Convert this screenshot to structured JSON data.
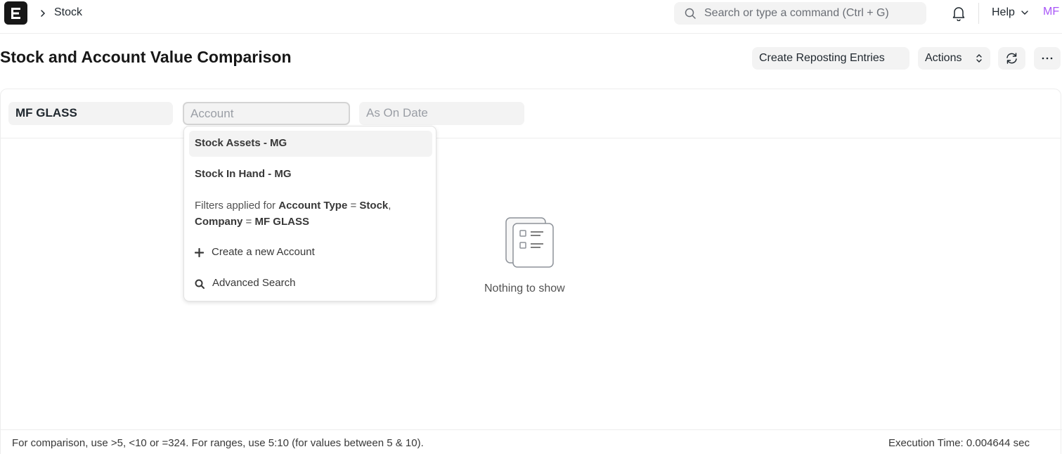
{
  "navbar": {
    "breadcrumb": "Stock",
    "search_placeholder": "Search or type a command (Ctrl + G)",
    "help_label": "Help",
    "avatar_initials": "MF"
  },
  "page": {
    "title": "Stock and Account Value Comparison",
    "buttons": {
      "reposting": "Create Reposting Entries",
      "actions": "Actions"
    }
  },
  "filters": {
    "company_value": "MF GLASS",
    "account_placeholder": "Account",
    "as_on_date_placeholder": "As On Date"
  },
  "dropdown": {
    "items": [
      {
        "label": "Stock Assets - MG",
        "active": true
      },
      {
        "label": "Stock In Hand - MG",
        "active": false
      }
    ],
    "filters_prefix": "Filters applied for",
    "filter_1_field": "Account Type",
    "filter_1_value": "Stock",
    "filter_2_field": "Company",
    "filter_2_value": "MF GLASS",
    "equals": "=",
    "create_label": "Create a new Account",
    "advanced_label": "Advanced Search"
  },
  "empty_state": {
    "message": "Nothing to show"
  },
  "footer": {
    "hint": "For comparison, use >5, <10 or =324. For ranges, use 5:10 (for values between 5 & 10).",
    "execution_time": "Execution Time: 0.004644 sec"
  },
  "colors": {
    "accent_avatar": "#a855f7",
    "control_bg": "#f3f3f3",
    "text": "#1f272e"
  }
}
